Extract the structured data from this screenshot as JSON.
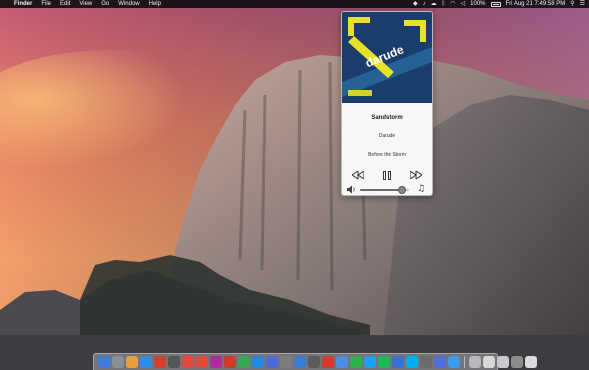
{
  "menubar": {
    "apple_glyph": "",
    "menus": [
      "Finder",
      "File",
      "Edit",
      "View",
      "Go",
      "Window",
      "Help"
    ],
    "battery": "100%",
    "clock": "Fri Aug 21  7:49:58 PM"
  },
  "player": {
    "album_art_text": "darude",
    "track": "Sandstorm",
    "artist": "Darude",
    "album": "Before the Storm",
    "volume_level": 0.85,
    "note_glyph": "♫"
  },
  "dock": {
    "app_icon_colors": [
      "#3d7bd8",
      "#8a8f96",
      "#e8a23a",
      "#2f8de4",
      "#d2402f",
      "#555555",
      "#e04a3b",
      "#e04a3b",
      "#b12c9a",
      "#cf3b2a",
      "#36a852",
      "#1e88e5",
      "#4b6bd6",
      "#7d7d7d",
      "#3a7bd5",
      "#5c5c5c",
      "#d9382e",
      "#4a8fe3",
      "#2fb24c",
      "#1da1f2",
      "#1db954",
      "#3c6fd1",
      "#00aff0",
      "#6b6b6b",
      "#4f6fd9",
      "#3d9be9"
    ],
    "utility_icon_colors": [
      "#b8b8b8",
      "#d8d8d8",
      "#c9c9c9",
      "#8c8c8c",
      "#dcdcdc"
    ]
  }
}
